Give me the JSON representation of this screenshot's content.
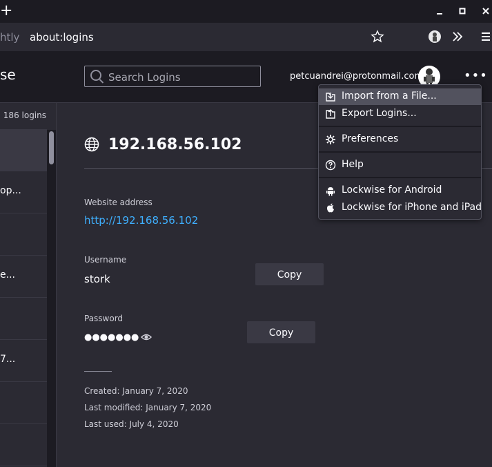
{
  "browser": {
    "tab_fragment": "htly",
    "url": "about:logins",
    "titlebar_new_tab": "+"
  },
  "header": {
    "brand_fragment": "se",
    "search_placeholder": "Search Logins",
    "account_email": "petcuandrei@protonmail.com",
    "menu_label": "•••"
  },
  "sidebar": {
    "count": "186 logins",
    "rows": [
      "",
      "op...",
      "",
      "e...",
      "",
      "7...",
      "",
      ""
    ]
  },
  "detail": {
    "title": "192.168.56.102",
    "website_label": "Website address",
    "website_value": "http://192.168.56.102",
    "username_label": "Username",
    "username_value": "stork",
    "password_label": "Password",
    "password_masked": "●●●●●●●",
    "copy_username": "Copy",
    "copy_password": "Copy",
    "created": "Created: January 7, 2020",
    "modified": "Last modified: January 7, 2020",
    "used": "Last used: July 4, 2020"
  },
  "menu": {
    "import": "Import from a File...",
    "export": "Export Logins...",
    "preferences": "Preferences",
    "help": "Help",
    "android": "Lockwise for Android",
    "iphone": "Lockwise for iPhone and iPad"
  },
  "colors": {
    "background": "#2b2a33",
    "header": "#1c1b22",
    "link": "#3fb0ff",
    "button": "#3a3944"
  }
}
